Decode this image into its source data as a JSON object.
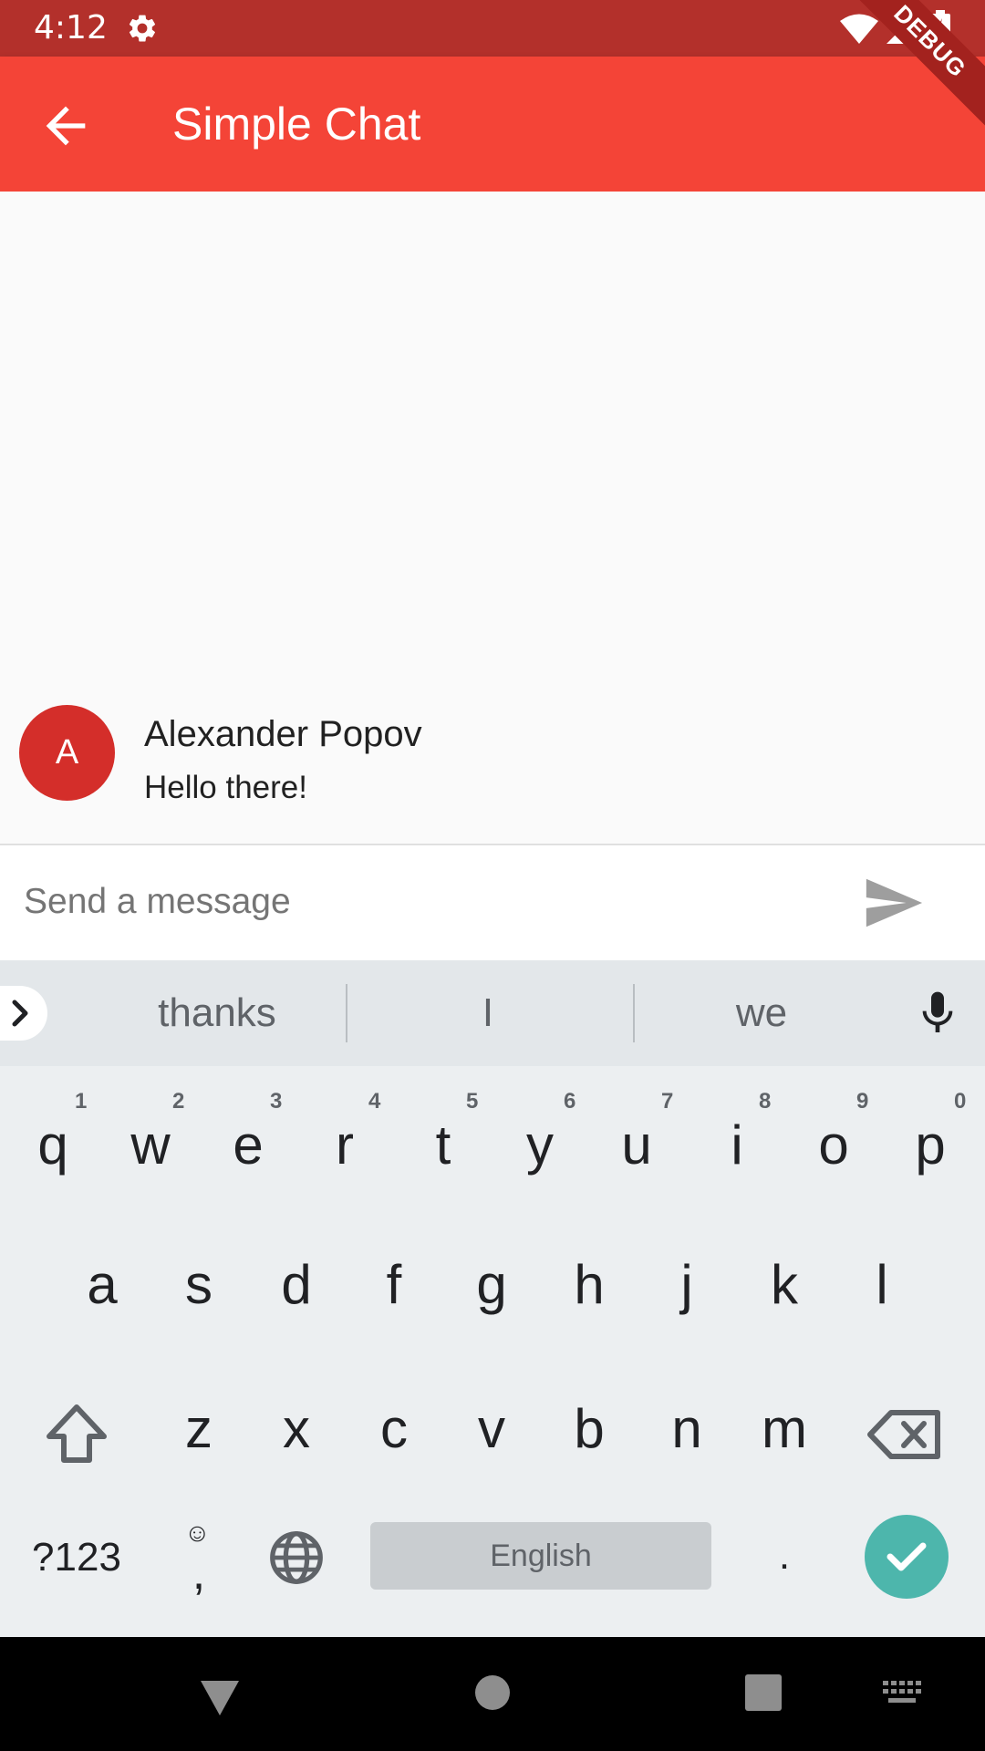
{
  "status_bar": {
    "time": "4:12",
    "icons": [
      "gear-icon",
      "wifi-icon",
      "signal-icon",
      "battery-icon"
    ]
  },
  "app_bar": {
    "title": "Simple Chat",
    "back_icon": "arrow-back-icon",
    "debug_banner": "DEBUG"
  },
  "messages": [
    {
      "avatar_initial": "A",
      "sender": "Alexander Popov",
      "text": "Hello there!"
    }
  ],
  "composer": {
    "placeholder": "Send a message",
    "send_icon": "send-icon"
  },
  "keyboard": {
    "suggestions": [
      "thanks",
      "I",
      "we"
    ],
    "row1": [
      "q",
      "w",
      "e",
      "r",
      "t",
      "y",
      "u",
      "i",
      "o",
      "p"
    ],
    "row1_hints": [
      "1",
      "2",
      "3",
      "4",
      "5",
      "6",
      "7",
      "8",
      "9",
      "0"
    ],
    "row2": [
      "a",
      "s",
      "d",
      "f",
      "g",
      "h",
      "j",
      "k",
      "l"
    ],
    "row3": [
      "z",
      "x",
      "c",
      "v",
      "b",
      "n",
      "m"
    ],
    "symbols_key": "?123",
    "comma_key": ",",
    "space_label": "English",
    "period_key": "."
  },
  "colors": {
    "status_bar": "#b3302b",
    "app_bar": "#f44437",
    "avatar": "#d42e2a",
    "done_key": "#4db6ac"
  }
}
